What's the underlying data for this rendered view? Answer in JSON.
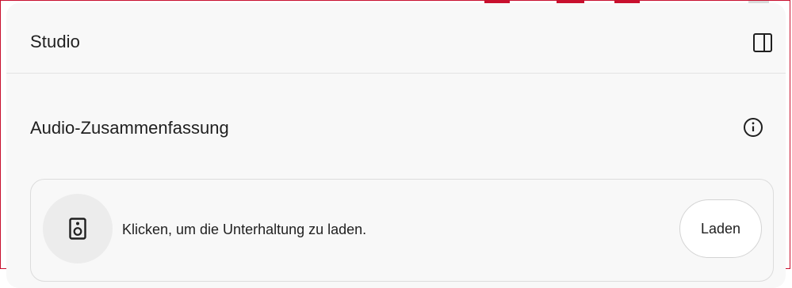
{
  "panel": {
    "title": "Studio",
    "collapse_icon": "side-panel-icon"
  },
  "audio_overview": {
    "title": "Audio-Zusammenfassung",
    "info_icon": "info-icon",
    "card": {
      "icon": "speaker-icon",
      "text": "Klicken, um die Unterhaltung zu laden.",
      "load_label": "Laden"
    }
  },
  "colors": {
    "accent_border": "#c8102e",
    "panel_background": "#f8f8f8",
    "text": "#1f1f1f"
  }
}
